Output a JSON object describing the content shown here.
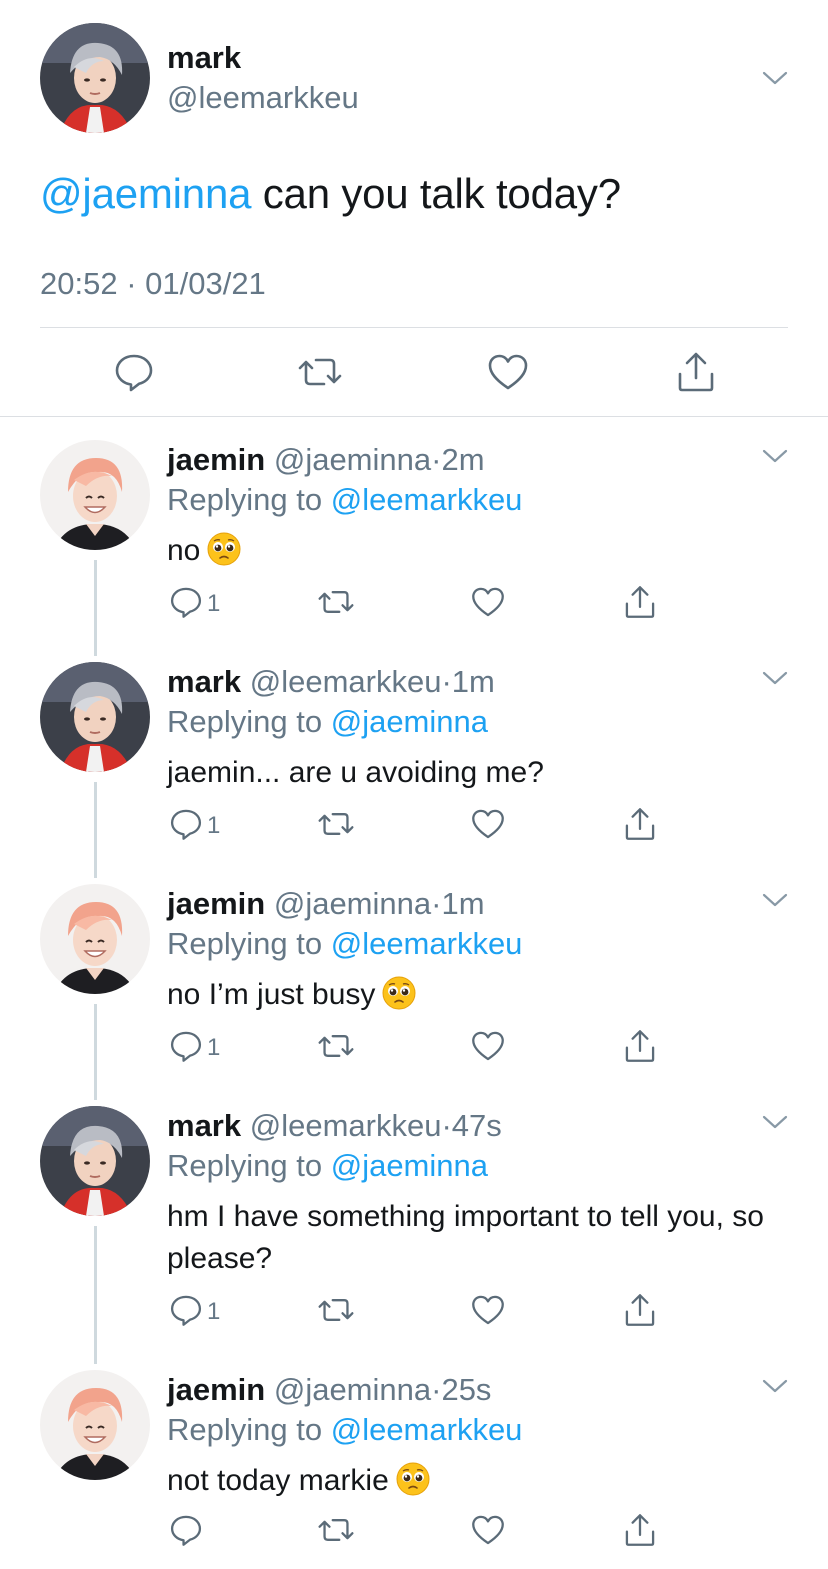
{
  "main_tweet": {
    "name": "mark",
    "handle": "@leemarkkeu",
    "mention": "@jaeminna",
    "text": " can you talk today?",
    "timestamp": "20:52 · 01/03/21",
    "avatar": "mark-avatar",
    "actions": [
      "reply-icon",
      "retweet-icon",
      "like-icon",
      "share-icon"
    ]
  },
  "replies": [
    {
      "name": "jaemin",
      "handle": "@jaeminna",
      "sep": "·",
      "time": "2m",
      "replying_prefix": "Replying to ",
      "replying_to": "@leemarkkeu",
      "text": "no",
      "emoji": "pleading-face-emoji",
      "reply_count": "1",
      "avatar": "jaemin-avatar"
    },
    {
      "name": "mark",
      "handle": "@leemarkkeu",
      "sep": "·",
      "time": "1m",
      "replying_prefix": "Replying to ",
      "replying_to": "@jaeminna",
      "text": "jaemin... are u avoiding me?",
      "emoji": null,
      "reply_count": "1",
      "avatar": "mark-avatar"
    },
    {
      "name": "jaemin",
      "handle": "@jaeminna",
      "sep": "·",
      "time": "1m",
      "replying_prefix": "Replying to ",
      "replying_to": "@leemarkkeu",
      "text": "no I’m just busy",
      "emoji": "pleading-face-emoji",
      "reply_count": "1",
      "avatar": "jaemin-avatar"
    },
    {
      "name": "mark",
      "handle": "@leemarkkeu",
      "sep": "·",
      "time": "47s",
      "replying_prefix": "Replying to ",
      "replying_to": "@jaeminna",
      "text": "hm I have something important to tell you, so please?",
      "emoji": null,
      "reply_count": "1",
      "avatar": "mark-avatar"
    },
    {
      "name": "jaemin",
      "handle": "@jaeminna",
      "sep": "·",
      "time": "25s",
      "replying_prefix": "Replying to ",
      "replying_to": "@leemarkkeu",
      "text": "not today markie",
      "emoji": "pleading-face-emoji",
      "reply_count": "",
      "avatar": "jaemin-avatar"
    }
  ],
  "colors": {
    "text": "#14171a",
    "secondary": "#657786",
    "link": "#1da1f2",
    "divider": "#dcdfe3",
    "thread_line": "#cfd9de"
  }
}
